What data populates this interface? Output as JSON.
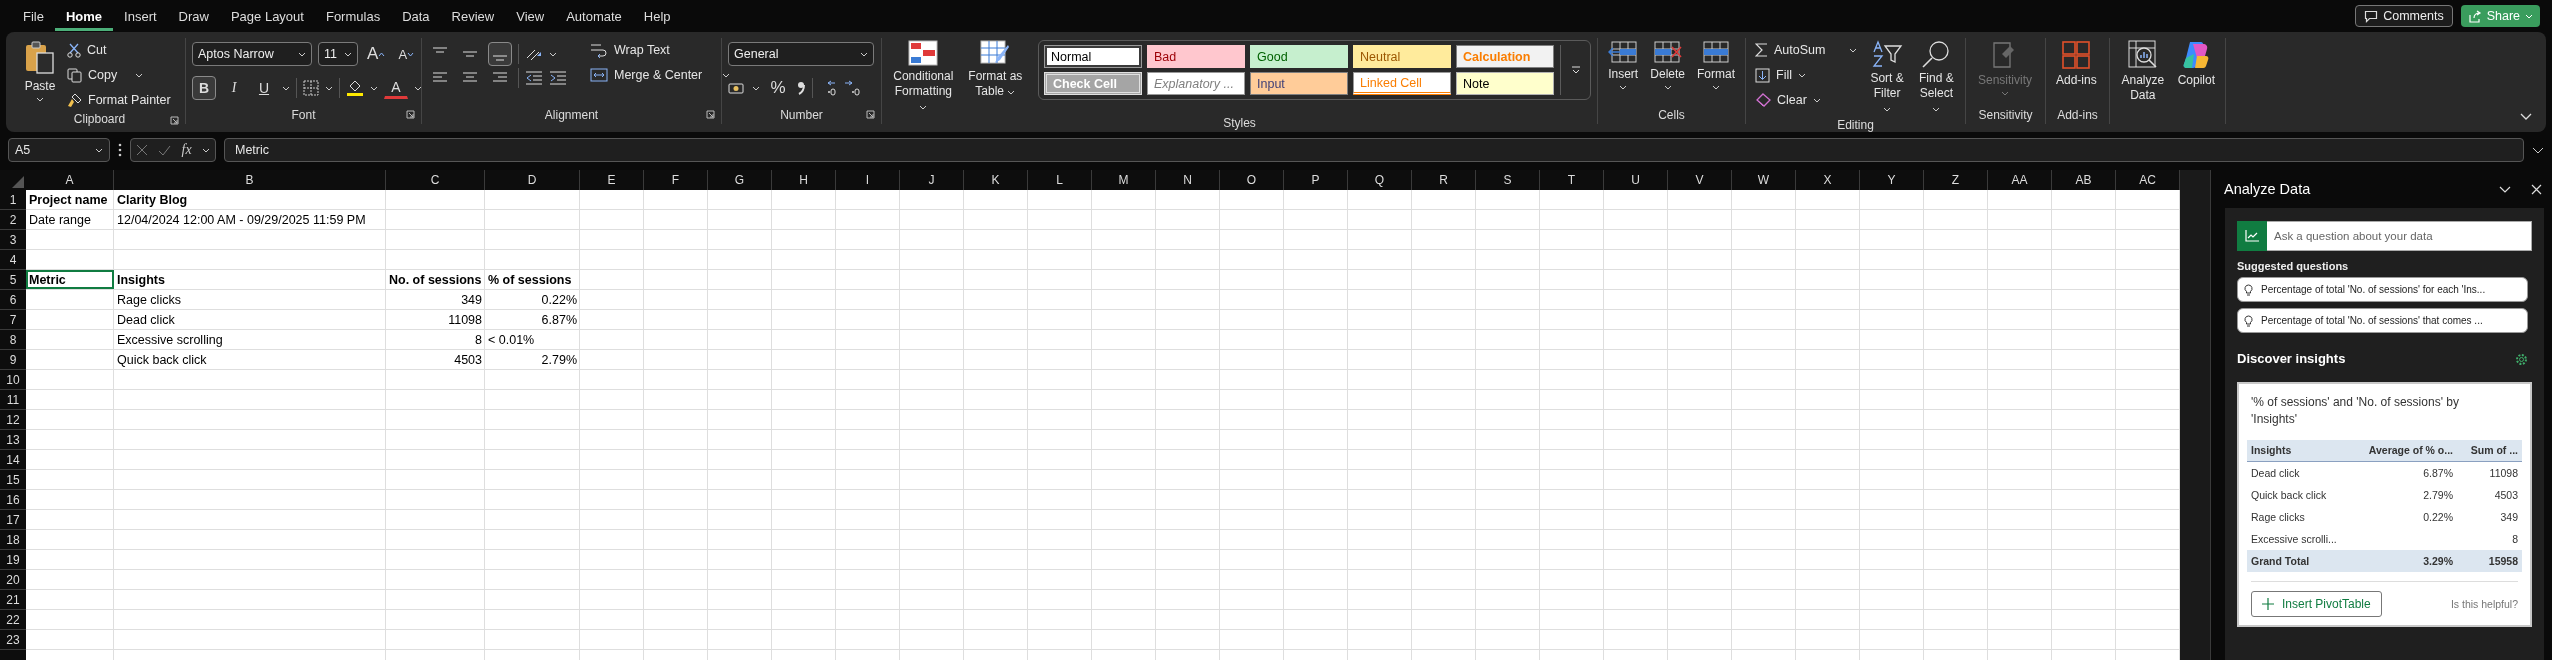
{
  "menu_tabs": [
    {
      "label": "File",
      "selected": false
    },
    {
      "label": "Home",
      "selected": true
    },
    {
      "label": "Insert",
      "selected": false
    },
    {
      "label": "Draw",
      "selected": false
    },
    {
      "label": "Page Layout",
      "selected": false
    },
    {
      "label": "Formulas",
      "selected": false
    },
    {
      "label": "Data",
      "selected": false
    },
    {
      "label": "Review",
      "selected": false
    },
    {
      "label": "View",
      "selected": false
    },
    {
      "label": "Automate",
      "selected": false
    },
    {
      "label": "Help",
      "selected": false
    }
  ],
  "top_buttons": {
    "comments": "Comments",
    "share": "Share"
  },
  "clipboard": {
    "label": "Clipboard",
    "paste": "Paste",
    "cut": "Cut",
    "copy": "Copy",
    "format_painter": "Format Painter"
  },
  "font": {
    "label": "Font",
    "family": "Aptos Narrow",
    "size": "11",
    "grow": "A",
    "shrink": "A",
    "toggles": [
      {
        "glyph": "B",
        "kind": "bold",
        "on": true
      },
      {
        "glyph": "I",
        "kind": "italic",
        "on": false
      },
      {
        "glyph": "U",
        "kind": "underline",
        "on": false
      }
    ],
    "font_color": "A"
  },
  "alignment": {
    "label": "Alignment",
    "vertical": [
      {
        "selected": false
      },
      {
        "selected": false
      },
      {
        "selected": true
      }
    ],
    "horizontal": [
      {
        "selected": false
      },
      {
        "selected": false
      },
      {
        "selected": false
      }
    ],
    "wrap_text": "Wrap Text",
    "merge": "Merge & Center"
  },
  "number": {
    "label": "Number",
    "format": "General",
    "percent": "%"
  },
  "styles": {
    "label": "Styles",
    "conditional": "Conditional Formatting",
    "format_table": "Format as Table",
    "cells": [
      {
        "label": "Normal",
        "kind": "normal",
        "selected": true
      },
      {
        "label": "Bad",
        "kind": "bad",
        "selected": false
      },
      {
        "label": "Good",
        "kind": "good",
        "selected": false
      },
      {
        "label": "Neutral",
        "kind": "neutral",
        "selected": false
      },
      {
        "label": "Calculation",
        "kind": "calculation",
        "selected": false
      },
      {
        "label": "Check Cell",
        "kind": "check",
        "selected": false
      },
      {
        "label": "Explanatory ...",
        "kind": "explanatory",
        "selected": false
      },
      {
        "label": "Input",
        "kind": "input",
        "selected": false
      },
      {
        "label": "Linked Cell",
        "kind": "linked",
        "selected": false
      },
      {
        "label": "Note",
        "kind": "note",
        "selected": false
      }
    ]
  },
  "cells_group": {
    "label": "Cells",
    "buttons": [
      {
        "label": "Insert",
        "kind": "insert"
      },
      {
        "label": "Delete",
        "kind": "delete"
      },
      {
        "label": "Format",
        "kind": "format"
      }
    ]
  },
  "editing": {
    "label": "Editing",
    "autosum": "AutoSum",
    "fill": "Fill",
    "clear": "Clear",
    "sort": "Sort & Filter",
    "find": "Find & Select"
  },
  "sensitivity": {
    "label": "Sensitivity",
    "button": "Sensitivity",
    "disabled": true
  },
  "addins": {
    "label": "Add-ins",
    "button": "Add-ins"
  },
  "analysis": {
    "analyze": "Analyze Data",
    "copilot": "Copilot"
  },
  "formula_bar": {
    "name_box": "A5",
    "fx": "fx",
    "value": "Metric"
  },
  "sheet": {
    "columns": [
      "A",
      "B",
      "C",
      "D",
      "E",
      "F",
      "G",
      "H",
      "I",
      "J",
      "K",
      "L",
      "M",
      "N",
      "O",
      "P",
      "Q",
      "R",
      "S",
      "T",
      "U",
      "V",
      "W",
      "X",
      "Y",
      "Z",
      "AA",
      "AB",
      "AC"
    ],
    "rows": [
      {
        "number": "1",
        "bold": true,
        "a": {
          "text": "Project name",
          "right_aligned": false,
          "selected": false
        },
        "b": {
          "text": "Clarity Blog",
          "right_aligned": false,
          "selected": false
        }
      },
      {
        "number": "2",
        "bold": false,
        "a": {
          "text": "Date range",
          "right_aligned": false,
          "selected": false
        },
        "b": {
          "text": "12/04/2024 12:00 AM - 09/29/2025 11:59 PM",
          "right_aligned": false,
          "selected": false
        }
      },
      {
        "number": "3"
      },
      {
        "number": "4"
      },
      {
        "number": "5",
        "bold": true,
        "a": {
          "text": "Metric",
          "right_aligned": false,
          "selected": true
        },
        "b": {
          "text": "Insights",
          "right_aligned": false,
          "selected": false
        },
        "c": {
          "text": "No. of sessions",
          "right_aligned": false,
          "selected": false
        },
        "d": {
          "text": "% of sessions",
          "right_aligned": false,
          "selected": false
        }
      },
      {
        "number": "6",
        "bold": false,
        "b": {
          "text": "Rage clicks",
          "right_aligned": false,
          "selected": false
        },
        "c": {
          "text": "349",
          "right_aligned": true,
          "selected": false
        },
        "d": {
          "text": "0.22%",
          "right_aligned": true,
          "selected": false
        }
      },
      {
        "number": "7",
        "bold": false,
        "b": {
          "text": "Dead click",
          "right_aligned": false,
          "selected": false
        },
        "c": {
          "text": "11098",
          "right_aligned": true,
          "selected": false
        },
        "d": {
          "text": "6.87%",
          "right_aligned": true,
          "selected": false
        }
      },
      {
        "number": "8",
        "bold": false,
        "b": {
          "text": "Excessive scrolling",
          "right_aligned": false,
          "selected": false
        },
        "c": {
          "text": "8",
          "right_aligned": true,
          "selected": false
        },
        "d": {
          "text": "< 0.01%",
          "right_aligned": false,
          "selected": false
        }
      },
      {
        "number": "9",
        "bold": false,
        "b": {
          "text": "Quick back click",
          "right_aligned": false,
          "selected": false
        },
        "c": {
          "text": "4503",
          "right_aligned": true,
          "selected": false
        },
        "d": {
          "text": "2.79%",
          "right_aligned": true,
          "selected": false
        }
      },
      {
        "number": "10"
      },
      {
        "number": "11"
      },
      {
        "number": "12"
      },
      {
        "number": "13"
      },
      {
        "number": "14"
      },
      {
        "number": "15"
      },
      {
        "number": "16"
      },
      {
        "number": "17"
      },
      {
        "number": "18"
      },
      {
        "number": "19"
      },
      {
        "number": "20"
      },
      {
        "number": "21"
      },
      {
        "number": "22"
      },
      {
        "number": "23"
      }
    ]
  },
  "panel": {
    "title": "Analyze Data",
    "search_placeholder": "Ask a question about your data",
    "suggested_label": "Suggested questions",
    "suggestions": [
      "Percentage of total 'No. of sessions' for each 'Ins...",
      "Percentage of total 'No. of sessions' that comes ..."
    ],
    "discover_label": "Discover insights",
    "card": {
      "title": "'% of sessions' and 'No. of sessions' by 'Insights'",
      "columns": [
        "Insights",
        "Average of % o...",
        "Sum of ..."
      ],
      "rows": [
        {
          "label": "Dead click",
          "average": "6.87%",
          "sum": "11098"
        },
        {
          "label": "Quick back click",
          "average": "2.79%",
          "sum": "4503"
        },
        {
          "label": "Rage clicks",
          "average": "0.22%",
          "sum": "349"
        },
        {
          "label": "Excessive scrolli...",
          "sum": "8"
        }
      ],
      "total": {
        "label": "Grand Total",
        "average": "3.29%",
        "sum": "15958"
      },
      "insert_button": "Insert PivotTable",
      "helpful": "Is this helpful?"
    }
  }
}
